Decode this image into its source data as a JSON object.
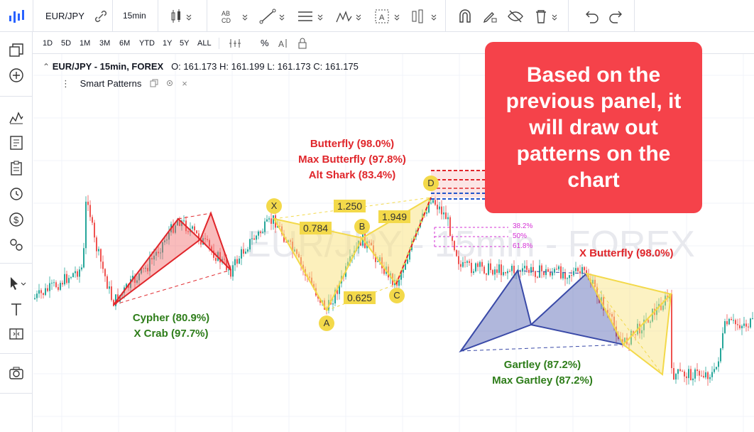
{
  "toolbar": {
    "symbol": "EUR/JPY",
    "interval": "15min",
    "tools": [
      "link-icon",
      "candles-icon",
      "text-tool-icon",
      "trend-line-icon",
      "horizontal-lines-icon",
      "pattern-icon",
      "annotation-icon",
      "bars-icon",
      "magnet-icon",
      "pencil-lock-icon",
      "eye-off-icon",
      "trash-icon",
      "undo-icon",
      "redo-icon"
    ]
  },
  "ranges": [
    "1D",
    "5D",
    "1M",
    "3M",
    "6M",
    "YTD",
    "1Y",
    "5Y",
    "ALL"
  ],
  "legend": {
    "title": "EUR/JPY - 15min, FOREX",
    "ohlc": "O: 161.173 H: 161.199 L: 161.173 C: 161.175",
    "indicator": "Smart Patterns"
  },
  "watermark": "EUR/JPY - 15min - FOREX",
  "callout": {
    "text": "Based on the previous panel, it will draw out patterns on the chart",
    "color": "#f5424a"
  },
  "pattern_labels": {
    "butterfly_group": [
      "Butterfly (98.0%)",
      "Max Butterfly (97.8%)",
      "Alt Shark (83.4%)"
    ],
    "cypher_group": [
      "Cypher (80.9%)",
      "X Crab (97.7%)"
    ],
    "x_butterfly": "X Butterfly (98.0%)",
    "gartley_group": [
      "Gartley (87.2%)",
      "Max Gartley (87.2%)"
    ]
  },
  "points": {
    "x": "X",
    "a": "A",
    "b": "B",
    "c": "C",
    "d": "D"
  },
  "ratios": {
    "xb": "0.784",
    "xd": "1.250",
    "bd": "1.949",
    "ac": "0.625"
  },
  "fib_levels": [
    "38.2%",
    "50%",
    "61.8%"
  ],
  "colors": {
    "red": "#e0262b",
    "green": "#2e7d1a",
    "yellow": "#f3d94a",
    "blue": "#3a4aa8",
    "up": "#26a69a",
    "down": "#ef5350",
    "magenta": "#d633d6"
  }
}
